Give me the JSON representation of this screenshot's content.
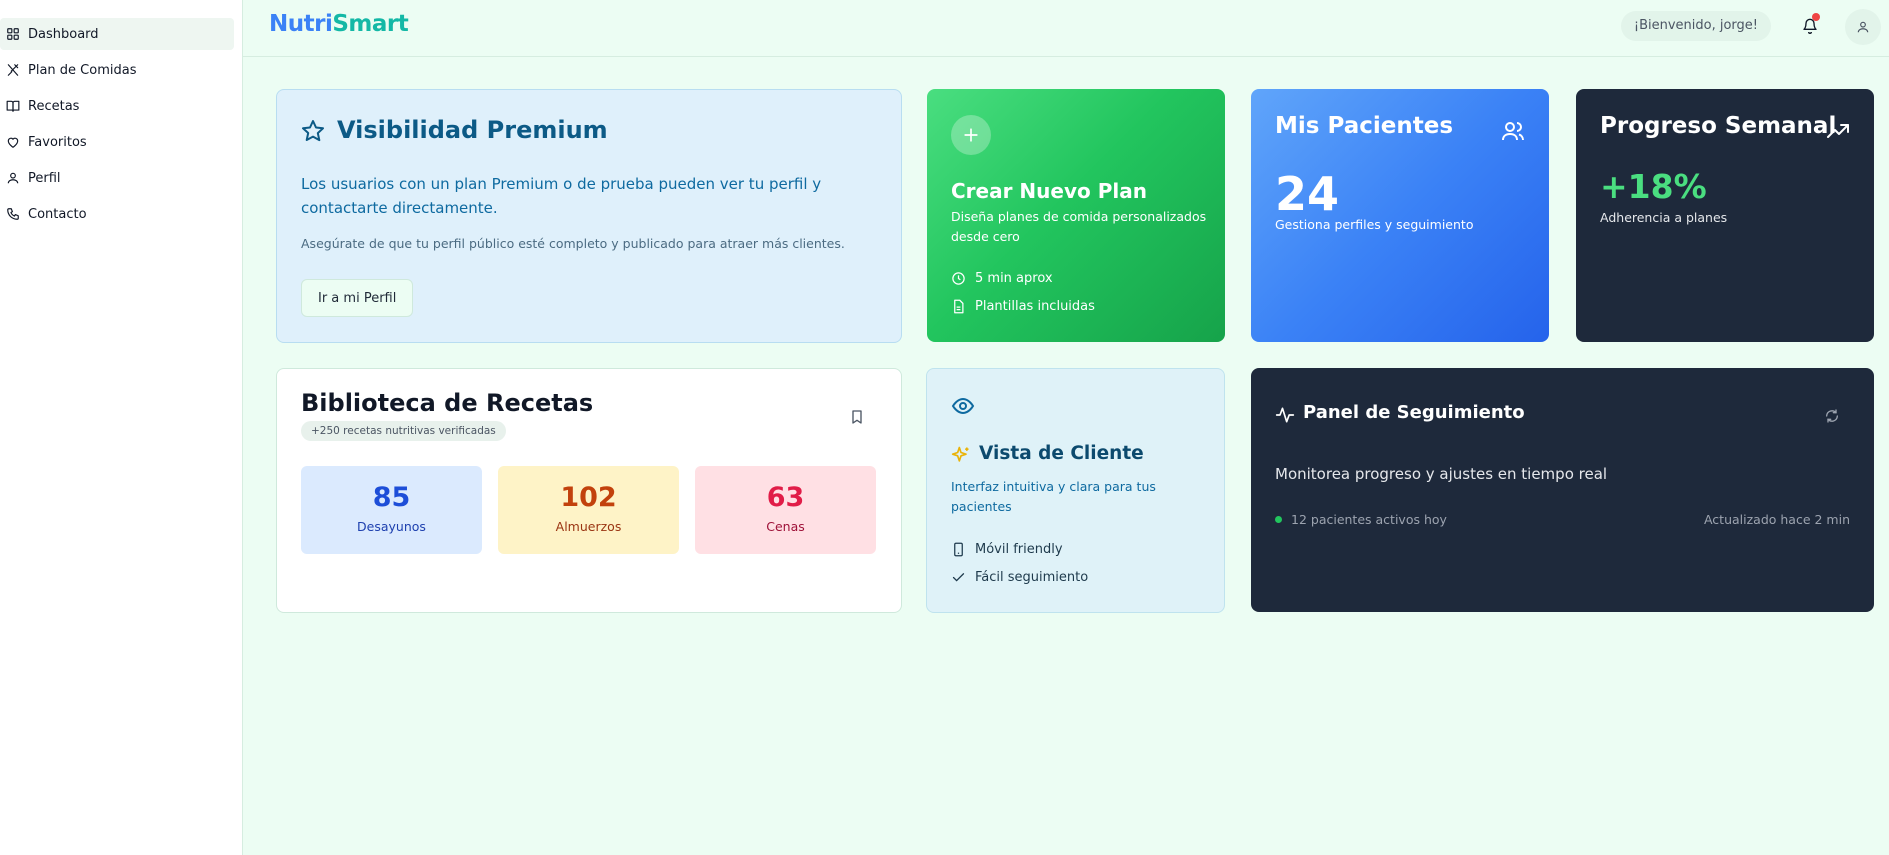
{
  "app": {
    "logo_part1": "Nutri",
    "logo_part2": "Smart"
  },
  "sidebar": {
    "items": [
      {
        "label": "Dashboard",
        "icon": "grid-icon"
      },
      {
        "label": "Plan de Comidas",
        "icon": "utensils-icon"
      },
      {
        "label": "Recetas",
        "icon": "book-icon"
      },
      {
        "label": "Favoritos",
        "icon": "heart-icon"
      },
      {
        "label": "Perfil",
        "icon": "user-icon"
      },
      {
        "label": "Contacto",
        "icon": "phone-icon"
      }
    ]
  },
  "header": {
    "welcome": "¡Bienvenido, jorge!"
  },
  "premium": {
    "title": "Visibilidad Premium",
    "text1": "Los usuarios con un plan Premium o de prueba pueden ver tu perfil y contactarte directamente.",
    "text2": "Asegúrate de que tu perfil público esté completo y publicado para atraer más clientes.",
    "button": "Ir a mi Perfil"
  },
  "new_plan": {
    "title": "Crear Nuevo Plan",
    "description": "Diseña planes de comida personalizados desde cero",
    "time": "5 min aprox",
    "templates": "Plantillas incluidas"
  },
  "patients": {
    "title": "Mis Pacientes",
    "count": "24",
    "subtitle": "Gestiona perfiles y seguimiento"
  },
  "progress": {
    "title": "Progreso Semanal",
    "value": "+18%",
    "subtitle": "Adherencia a planes"
  },
  "library": {
    "title": "Biblioteca de Recetas",
    "badge": "+250 recetas nutritivas verificadas",
    "stats": [
      {
        "value": "85",
        "label": "Desayunos",
        "bg": "#dbeafe",
        "color": "#1d4ed8"
      },
      {
        "value": "102",
        "label": "Almuerzos",
        "bg": "#fef3c7",
        "color": "#c2410c"
      },
      {
        "value": "63",
        "label": "Cenas",
        "bg": "#ffe0e4",
        "color": "#e11d48"
      }
    ]
  },
  "client_view": {
    "title": "Vista de Cliente",
    "description": "Interfaz intuitiva y clara para tus pacientes",
    "feature1": "Móvil friendly",
    "feature2": "Fácil seguimiento"
  },
  "tracking": {
    "title": "Panel de Seguimiento",
    "description": "Monitorea progreso y ajustes en tiempo real",
    "active": "12 pacientes activos hoy",
    "updated": "Actualizado hace 2 min"
  },
  "colors": {
    "background": "#ecfdf3",
    "accent_blue": "#3b82f6",
    "accent_teal": "#14b8a6",
    "accent_green": "#22c55e",
    "dark": "#1e293b"
  }
}
